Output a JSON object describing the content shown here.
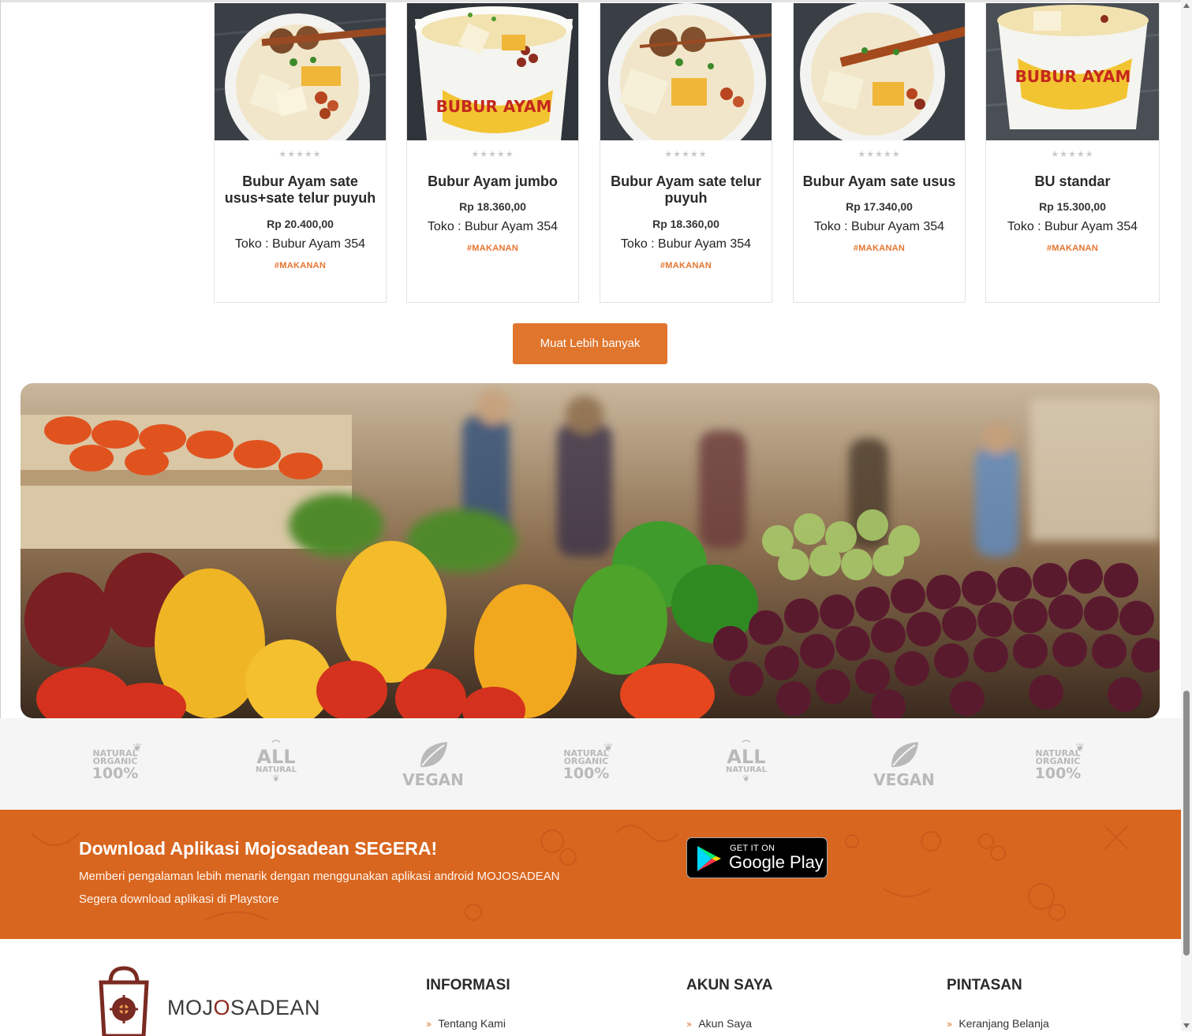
{
  "products": [
    {
      "title": "Bubur Ayam sate usus+sate telur puyuh",
      "price": "Rp 20.400,00",
      "store": "Toko : Bubur Ayam 354",
      "tag": "#MAKANAN",
      "rating": 0
    },
    {
      "title": "Bubur Ayam jumbo",
      "price": "Rp 18.360,00",
      "store": "Toko : Bubur Ayam 354",
      "tag": "#MAKANAN",
      "rating": 0
    },
    {
      "title": "Bubur Ayam sate telur puyuh",
      "price": "Rp 18.360,00",
      "store": "Toko : Bubur Ayam 354",
      "tag": "#MAKANAN",
      "rating": 0
    },
    {
      "title": "Bubur Ayam sate usus",
      "price": "Rp 17.340,00",
      "store": "Toko : Bubur Ayam 354",
      "tag": "#MAKANAN",
      "rating": 0
    },
    {
      "title": "BU standar",
      "price": "Rp 15.300,00",
      "store": "Toko : Bubur Ayam 354",
      "tag": "#MAKANAN",
      "rating": 0
    }
  ],
  "stars_glyph": "★★★★★",
  "load_more_label": "Muat Lebih banyak",
  "badges": [
    {
      "type": "natural-organic",
      "line1": "NATURAL",
      "line2": "ORGANIC",
      "line3": "100%"
    },
    {
      "type": "all-natural",
      "line1": "ALL",
      "line2": "NATURAL"
    },
    {
      "type": "vegan",
      "line1": "VEGAN"
    },
    {
      "type": "natural-organic",
      "line1": "NATURAL",
      "line2": "ORGANIC",
      "line3": "100%"
    },
    {
      "type": "all-natural",
      "line1": "ALL",
      "line2": "NATURAL"
    },
    {
      "type": "vegan",
      "line1": "VEGAN"
    },
    {
      "type": "natural-organic",
      "line1": "NATURAL",
      "line2": "ORGANIC",
      "line3": "100%"
    }
  ],
  "app_promo": {
    "title": "Download Aplikasi Mojosadean SEGERA!",
    "line1": "Memberi pengalaman lebih menarik dengan menggunakan aplikasi android MOJOSADEAN",
    "line2": "Segera download aplikasi di Playstore",
    "store_badge": {
      "small": "GET IT ON",
      "big": "Google Play"
    }
  },
  "footer": {
    "brand": {
      "part1": "MOJ",
      "part2": "O",
      "part3": "SADEAN"
    },
    "columns": [
      {
        "heading": "INFORMASI",
        "first_link": "Tentang Kami"
      },
      {
        "heading": "AKUN SAYA",
        "first_link": "Akun Saya"
      },
      {
        "heading": "PINTASAN",
        "first_link": "Keranjang Belanja"
      }
    ],
    "chevron": "»"
  },
  "colors": {
    "accent": "#e0752d",
    "promo_bg": "#d9661f",
    "tag": "#e57530"
  }
}
